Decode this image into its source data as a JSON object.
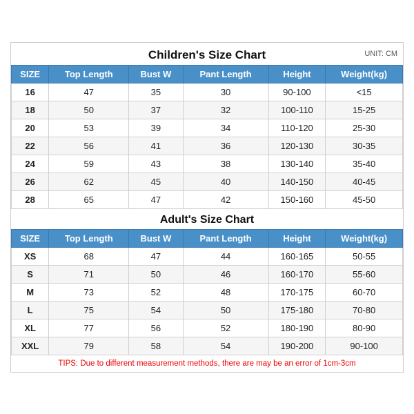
{
  "title": "Children's Size Chart",
  "unit": "UNIT: CM",
  "adults_title": "Adult's Size Chart",
  "children_headers": [
    "SIZE",
    "Top Length",
    "Bust W",
    "Pant Length",
    "Height",
    "Weight(kg)"
  ],
  "children_rows": [
    [
      "16",
      "47",
      "35",
      "30",
      "90-100",
      "<15"
    ],
    [
      "18",
      "50",
      "37",
      "32",
      "100-110",
      "15-25"
    ],
    [
      "20",
      "53",
      "39",
      "34",
      "110-120",
      "25-30"
    ],
    [
      "22",
      "56",
      "41",
      "36",
      "120-130",
      "30-35"
    ],
    [
      "24",
      "59",
      "43",
      "38",
      "130-140",
      "35-40"
    ],
    [
      "26",
      "62",
      "45",
      "40",
      "140-150",
      "40-45"
    ],
    [
      "28",
      "65",
      "47",
      "42",
      "150-160",
      "45-50"
    ]
  ],
  "adults_headers": [
    "SIZE",
    "Top Length",
    "Bust W",
    "Pant Length",
    "Height",
    "Weight(kg)"
  ],
  "adults_rows": [
    [
      "XS",
      "68",
      "47",
      "44",
      "160-165",
      "50-55"
    ],
    [
      "S",
      "71",
      "50",
      "46",
      "160-170",
      "55-60"
    ],
    [
      "M",
      "73",
      "52",
      "48",
      "170-175",
      "60-70"
    ],
    [
      "L",
      "75",
      "54",
      "50",
      "175-180",
      "70-80"
    ],
    [
      "XL",
      "77",
      "56",
      "52",
      "180-190",
      "80-90"
    ],
    [
      "XXL",
      "79",
      "58",
      "54",
      "190-200",
      "90-100"
    ]
  ],
  "tips": "TIPS: Due to different measurement methods, there are may be an error of 1cm-3cm"
}
